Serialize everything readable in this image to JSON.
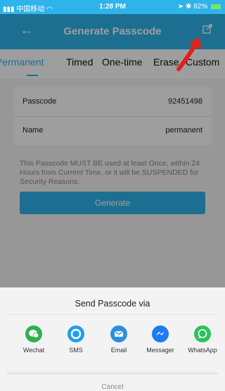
{
  "statusbar": {
    "carrier": "中国移动",
    "time": "1:28 PM",
    "battery": "82%"
  },
  "navbar": {
    "title": "Generate Passcode"
  },
  "tabs": [
    {
      "label": "Permanent",
      "active": true
    },
    {
      "label": "Timed",
      "active": false
    },
    {
      "label": "One-time",
      "active": false
    },
    {
      "label": "Erase",
      "active": false
    },
    {
      "label": "Custom",
      "active": false
    }
  ],
  "form": {
    "passcode_label": "Passcode",
    "passcode_value": "92451498",
    "name_label": "Name",
    "name_value": "permanent",
    "notice": "This Passcode MUST BE used at least Once, within 24 Hours from Current Time, or it will be SUSPENDED for Security Reasons.",
    "generate_label": "Generate"
  },
  "share_sheet": {
    "title": "Send Passcode via",
    "options": [
      {
        "label": "Wechat",
        "icon": "wechat-icon",
        "color": "#2bb24c"
      },
      {
        "label": "SMS",
        "icon": "sms-icon",
        "color": "#1e9ef0"
      },
      {
        "label": "Email",
        "icon": "email-icon",
        "color": "#2b8fe0"
      },
      {
        "label": "Messager",
        "icon": "messenger-icon",
        "color": "#1f7bf2"
      },
      {
        "label": "WhatsApp",
        "icon": "whatsapp-icon",
        "color": "#2ec15a"
      }
    ],
    "cancel_label": "Cancel"
  },
  "colors": {
    "accent": "#2eb3ea",
    "annotation": "#e3201b"
  }
}
